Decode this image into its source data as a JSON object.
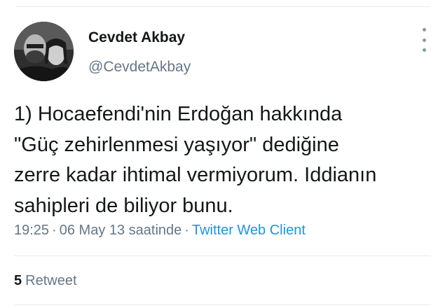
{
  "tweet": {
    "author": {
      "name": "Cevdet Akbay",
      "handle": "@CevdetAkbay"
    },
    "text_lines": [
      "1) Hocaefendi'nin Erdoğan hakkında",
      "\"Güç zehirlenmesi yaşıyor\" dediğine",
      "zerre kadar ihtimal vermiyorum. Iddianın",
      "sahipleri de biliyor bunu."
    ],
    "time": "19:25",
    "separator": "·",
    "date": "06 May 13 saatinde",
    "source": "Twitter Web Client",
    "retweet_count": "5",
    "retweet_label": "Retweet"
  },
  "icons": {
    "menu": "more-vertical-icon"
  },
  "colors": {
    "text": "#14171a",
    "secondary": "#657786",
    "link": "#1b95e0",
    "divider": "#e6ecf0"
  }
}
